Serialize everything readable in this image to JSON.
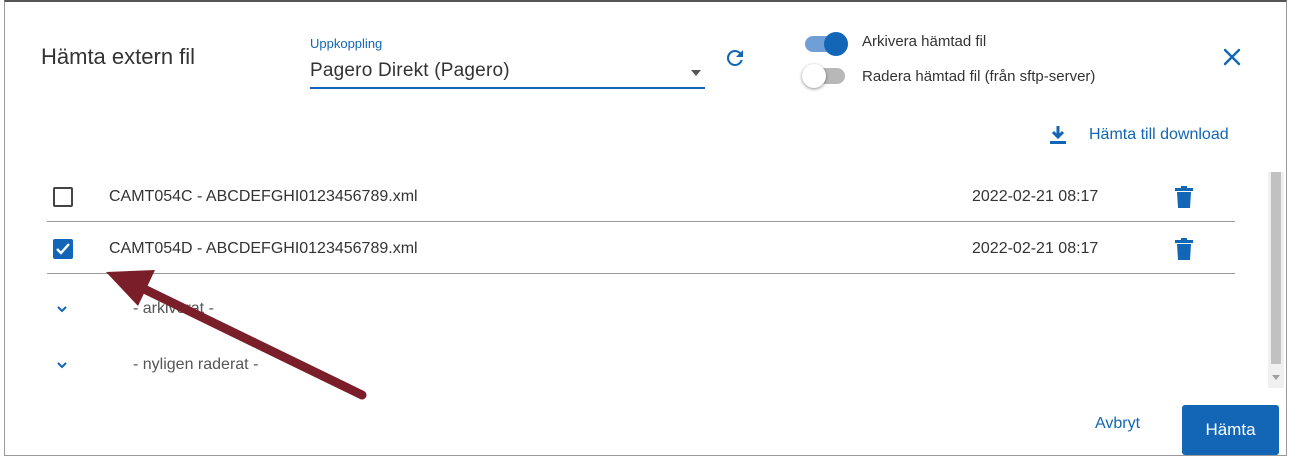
{
  "dialog": {
    "title": "Hämta extern fil",
    "connection": {
      "label": "Uppkoppling",
      "value": "Pagero Direkt (Pagero)"
    },
    "refresh_icon": "refresh-icon",
    "toggles": [
      {
        "label": "Arkivera hämtad fil",
        "on": true
      },
      {
        "label": "Radera hämtad fil (från sftp-server)",
        "on": false
      }
    ],
    "close_icon": "close-icon",
    "download": {
      "label": "Hämta till download",
      "icon": "download-icon"
    },
    "files": [
      {
        "name": "CAMT054C - ABCDEFGHI0123456789.xml",
        "date": "2022-02-21 08:17",
        "checked": false
      },
      {
        "name": "CAMT054D - ABCDEFGHI0123456789.xml",
        "date": "2022-02-21 08:17",
        "checked": true
      }
    ],
    "groups": [
      {
        "label": "- arkiverat -",
        "icon": "chevron-down-icon"
      },
      {
        "label": "- nyligen raderat -",
        "icon": "chevron-down-icon"
      }
    ],
    "buttons": {
      "cancel": "Avbryt",
      "submit": "Hämta"
    }
  },
  "colors": {
    "accent": "#1266b5",
    "annotation_arrow": "#7a1f2a"
  }
}
